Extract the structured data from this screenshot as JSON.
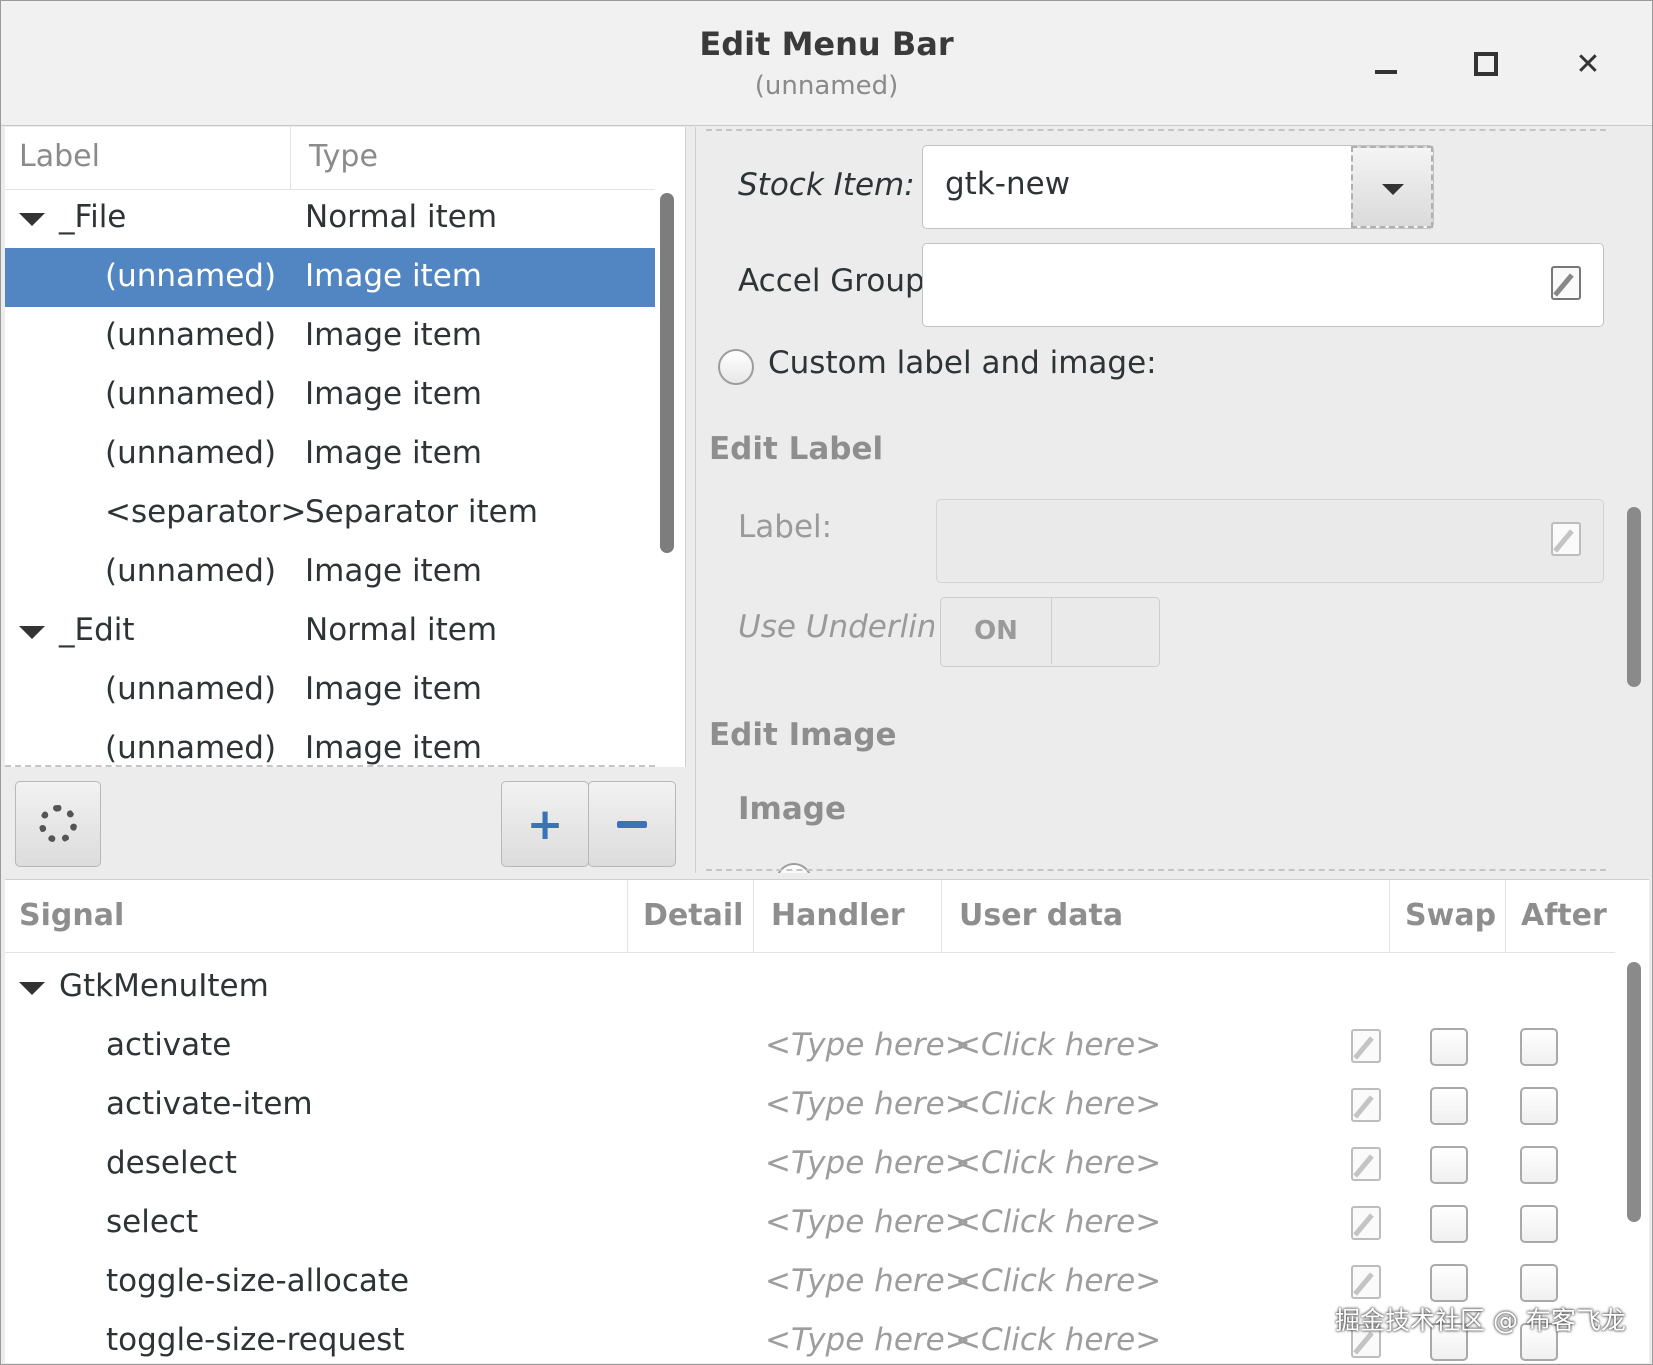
{
  "window": {
    "title": "Edit Menu Bar",
    "subtitle": "(unnamed)"
  },
  "tree": {
    "headers": {
      "label": "Label",
      "type": "Type"
    },
    "rows": [
      {
        "label": "_File",
        "type": "Normal item"
      },
      {
        "label": "(unnamed)",
        "type": "Image item"
      },
      {
        "label": "(unnamed)",
        "type": "Image item"
      },
      {
        "label": "(unnamed)",
        "type": "Image item"
      },
      {
        "label": "(unnamed)",
        "type": "Image item"
      },
      {
        "label": "<separator>",
        "type": "Separator item"
      },
      {
        "label": "(unnamed)",
        "type": "Image item"
      },
      {
        "label": "_Edit",
        "type": "Normal item"
      },
      {
        "label": "(unnamed)",
        "type": "Image item"
      },
      {
        "label": "(unnamed)",
        "type": "Image item"
      }
    ],
    "selected_row": 1,
    "buttons": {
      "add": "+",
      "remove": "−"
    }
  },
  "properties": {
    "stock_item_label": "Stock Item:",
    "stock_item_value": "gtk-new",
    "accel_group_label": "Accel Group:",
    "accel_group_value": "",
    "custom_label_radio": "Custom label and image:",
    "edit_label_heading": "Edit Label",
    "label_field_label": "Label:",
    "use_underline_label": "Use Underline:",
    "use_underline_value": "ON",
    "edit_image_heading": "Edit Image",
    "image_heading": "Image"
  },
  "signals": {
    "headers": {
      "signal": "Signal",
      "detail": "Detail",
      "handler": "Handler",
      "user_data": "User data",
      "swap": "Swap",
      "after": "After"
    },
    "group": "GtkMenuItem",
    "handler_placeholder": "<Type here>",
    "user_data_placeholder": "<Click here>",
    "rows": [
      {
        "name": "activate"
      },
      {
        "name": "activate-item"
      },
      {
        "name": "deselect"
      },
      {
        "name": "select"
      },
      {
        "name": "toggle-size-allocate"
      },
      {
        "name": "toggle-size-request"
      }
    ]
  },
  "watermark": "掘金技术社区 @ 布客飞龙",
  "colors": {
    "selection": "#5286c2",
    "accent_icon": "#3b73b9"
  }
}
